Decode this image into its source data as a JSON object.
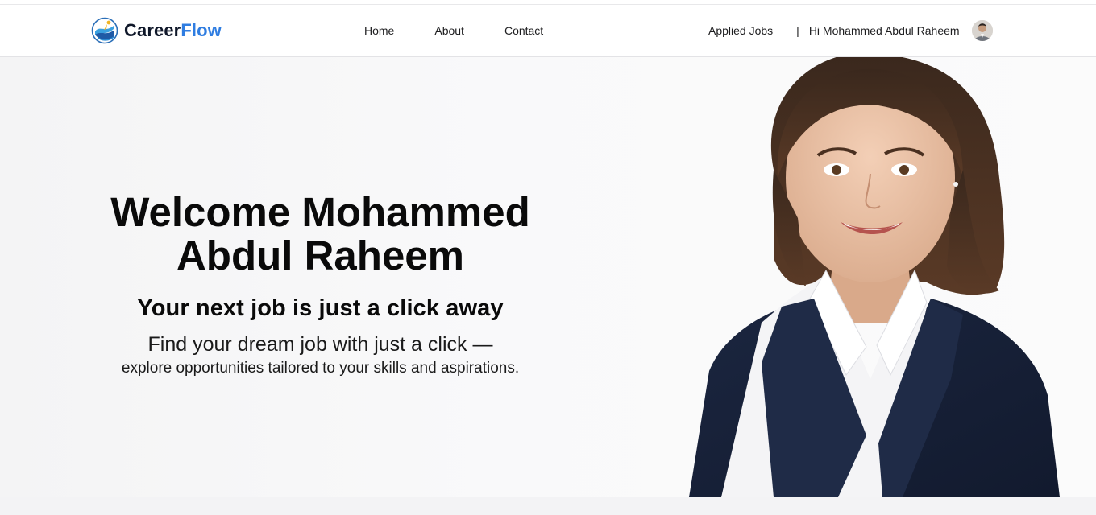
{
  "brand": {
    "name_part1": "Career",
    "name_part2": "Flow",
    "logo_icon": "careerflow-logo-icon",
    "colors": {
      "primary": "#0f1729",
      "accent": "#2f7de1"
    }
  },
  "nav": {
    "links": [
      {
        "label": "Home"
      },
      {
        "label": "About"
      },
      {
        "label": "Contact"
      }
    ],
    "applied_jobs": "Applied Jobs",
    "separator": "|",
    "greeting": "Hi Mohammed Abdul Raheem",
    "avatar_icon": "user-avatar-icon"
  },
  "hero": {
    "title_line1": "Welcome Mohammed",
    "title_line2": "Abdul Raheem",
    "subtitle": "Your next job is just a click away",
    "line1": "Find your dream job with just a click —",
    "line2": "explore opportunities tailored to your skills and aspirations.",
    "image": "professional-woman-portrait"
  }
}
